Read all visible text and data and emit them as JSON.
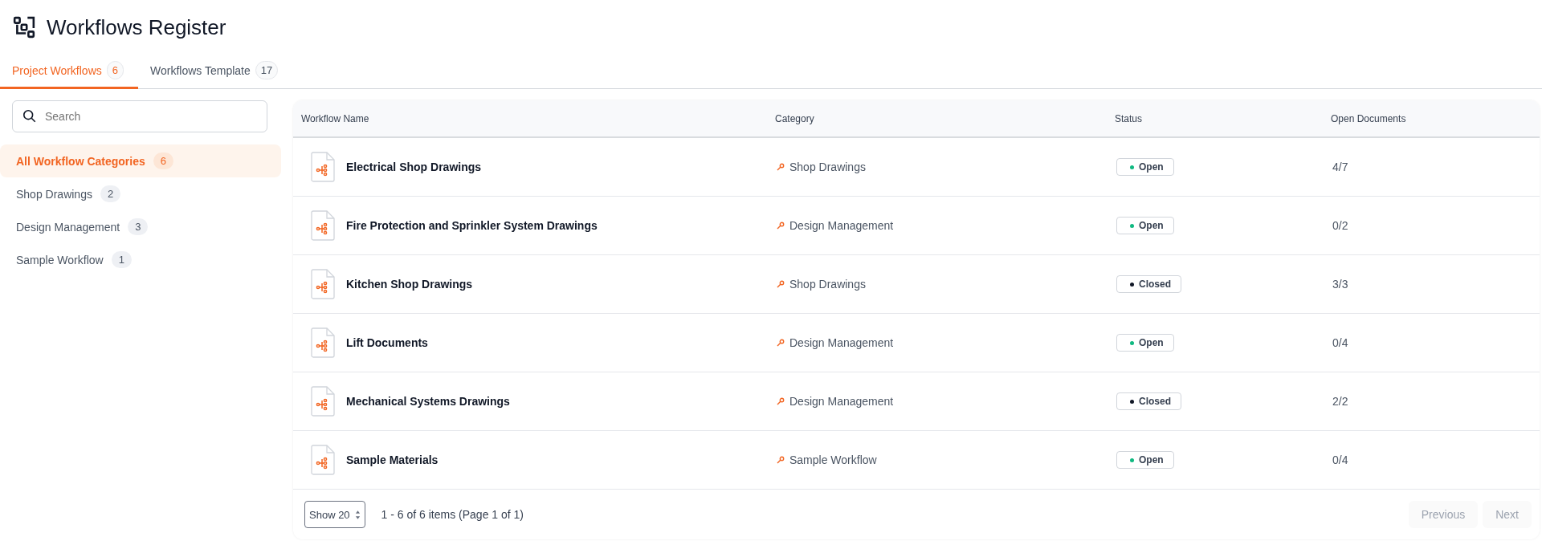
{
  "page": {
    "title": "Workflows Register"
  },
  "tabs": [
    {
      "label": "Project Workflows",
      "count": "6",
      "selected": true
    },
    {
      "label": "Workflows Template",
      "count": "17",
      "selected": false
    }
  ],
  "sidebar": {
    "search": {
      "placeholder": "Search"
    },
    "items": [
      {
        "label": "All Workflow Categories",
        "count": "6",
        "selected": true
      },
      {
        "label": "Shop Drawings",
        "count": "2",
        "selected": false
      },
      {
        "label": "Design Management",
        "count": "3",
        "selected": false
      },
      {
        "label": "Sample Workflow",
        "count": "1",
        "selected": false
      }
    ]
  },
  "table": {
    "columns": [
      "Workflow Name",
      "Category",
      "Status",
      "Open Documents"
    ],
    "rows": [
      {
        "name": "Electrical Shop Drawings",
        "category": "Shop Drawings",
        "status": "Open",
        "open": true,
        "documents": "4/7"
      },
      {
        "name": "Fire Protection and Sprinkler System Drawings",
        "category": "Design Management",
        "status": "Open",
        "open": true,
        "documents": "0/2"
      },
      {
        "name": "Kitchen Shop Drawings",
        "category": "Shop Drawings",
        "status": "Closed",
        "open": false,
        "documents": "3/3"
      },
      {
        "name": "Lift Documents",
        "category": "Design Management",
        "status": "Open",
        "open": true,
        "documents": "0/4"
      },
      {
        "name": "Mechanical Systems Drawings",
        "category": "Design Management",
        "status": "Closed",
        "open": false,
        "documents": "2/2"
      },
      {
        "name": "Sample Materials",
        "category": "Sample Workflow",
        "status": "Open",
        "open": true,
        "documents": "0/4"
      }
    ]
  },
  "pagination": {
    "page_size": "Show 20",
    "summary": "1 - 6 of 6 items (Page 1 of 1)",
    "buttons": [
      {
        "label": "Previous",
        "disabled": true
      },
      {
        "label": "Next",
        "disabled": true
      }
    ]
  }
}
